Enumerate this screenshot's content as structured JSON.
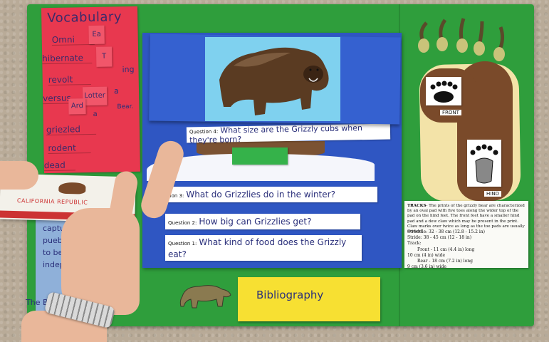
{
  "vocabulary": {
    "title": "Vocabulary",
    "words": [
      "Omni",
      "hibernate",
      "revolt",
      "versus",
      "griezled",
      "rodent",
      "dead"
    ],
    "flaps": [
      "Ea",
      "T",
      "Lotter a",
      "Ard"
    ],
    "margin_marks": [
      "ing",
      "a",
      "Bear."
    ]
  },
  "flag_card": {
    "banner": "CALIFORNIA REPUBLIC"
  },
  "notes": {
    "lines": [
      "captured",
      "pueblo",
      "to be",
      "indepe"
    ],
    "footer": "The B"
  },
  "questions": [
    {
      "label": "Question 4:",
      "text": "What size are the Grizzly cubs when they're born?"
    },
    {
      "label": "Question 3:",
      "text": "What do Grizzlies do in the winter?"
    },
    {
      "label": "Question 2:",
      "text": "How big can Grizzlies get?"
    },
    {
      "label": "Question 1:",
      "text": "What kind of food does the Grizzly eat?"
    }
  ],
  "bibliography": {
    "label": "Bibliography"
  },
  "tracks": {
    "front_label": "FRONT",
    "hind_label": "HIND",
    "heading": "TRACKS",
    "body": "- The prints of the grizzly bear are characterized by an oval pad with five toes along the wider top of the pad on the hind feet. The front feet have a smaller hind pad and a dew claw which may be present in the print. Claw marks over twice as long as the toe pads are usually evident.",
    "measurements": [
      "Straddle: 32 - 38 cm (12.8 - 15.2 in)",
      "Stride: 38 - 45 cm (12 - 18 in)",
      "Track:",
      "Front - 11 cm (4.4 in) long",
      "10 cm (4 in) wide",
      "Rear - 18 cm (7.2 in) long",
      "9 cm (3.6 in) wide"
    ]
  },
  "colors": {
    "folder": "#2f9e3c",
    "vocab_panel": "#e8384f",
    "blue_book": "#2f56c2",
    "bibliography_card": "#f7e032",
    "paw_print": "#7a4a2a"
  }
}
